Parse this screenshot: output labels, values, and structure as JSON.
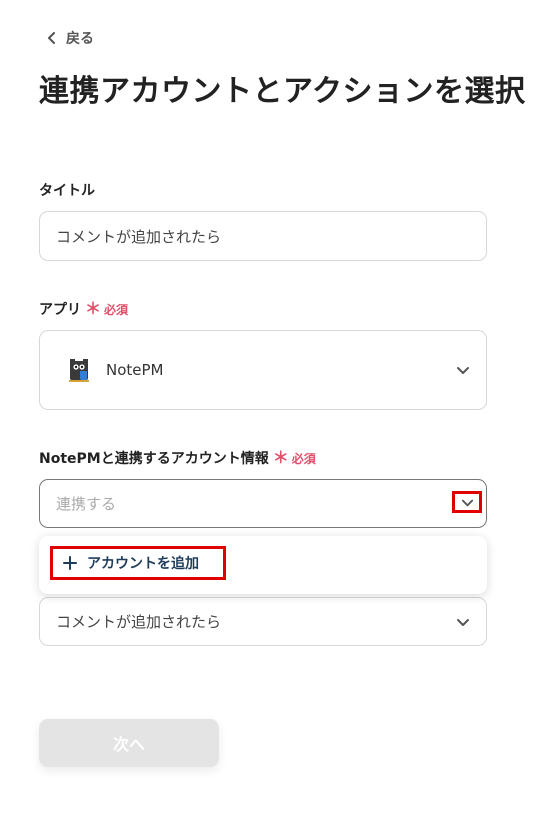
{
  "header": {
    "back_label": "戻る",
    "page_title": "連携アカウントとアクションを選択"
  },
  "form": {
    "title_label": "タイトル",
    "title_value": "コメントが追加されたら",
    "app_label": "アプリ",
    "required_mark": "＊",
    "required_text": "必須",
    "app_value": "NotePM",
    "account_label": "NotePMと連携するアカウント情報",
    "account_placeholder": "連携する",
    "trigger_value": "コメントが追加されたら"
  },
  "dropdown": {
    "add_account_label": "アカウントを追加"
  },
  "footer": {
    "next_label": "次へ"
  },
  "colors": {
    "required": "#e0506a",
    "highlight": "#e00000",
    "disabled_button": "#e4e4e4",
    "add_text": "#1e3c5a"
  }
}
